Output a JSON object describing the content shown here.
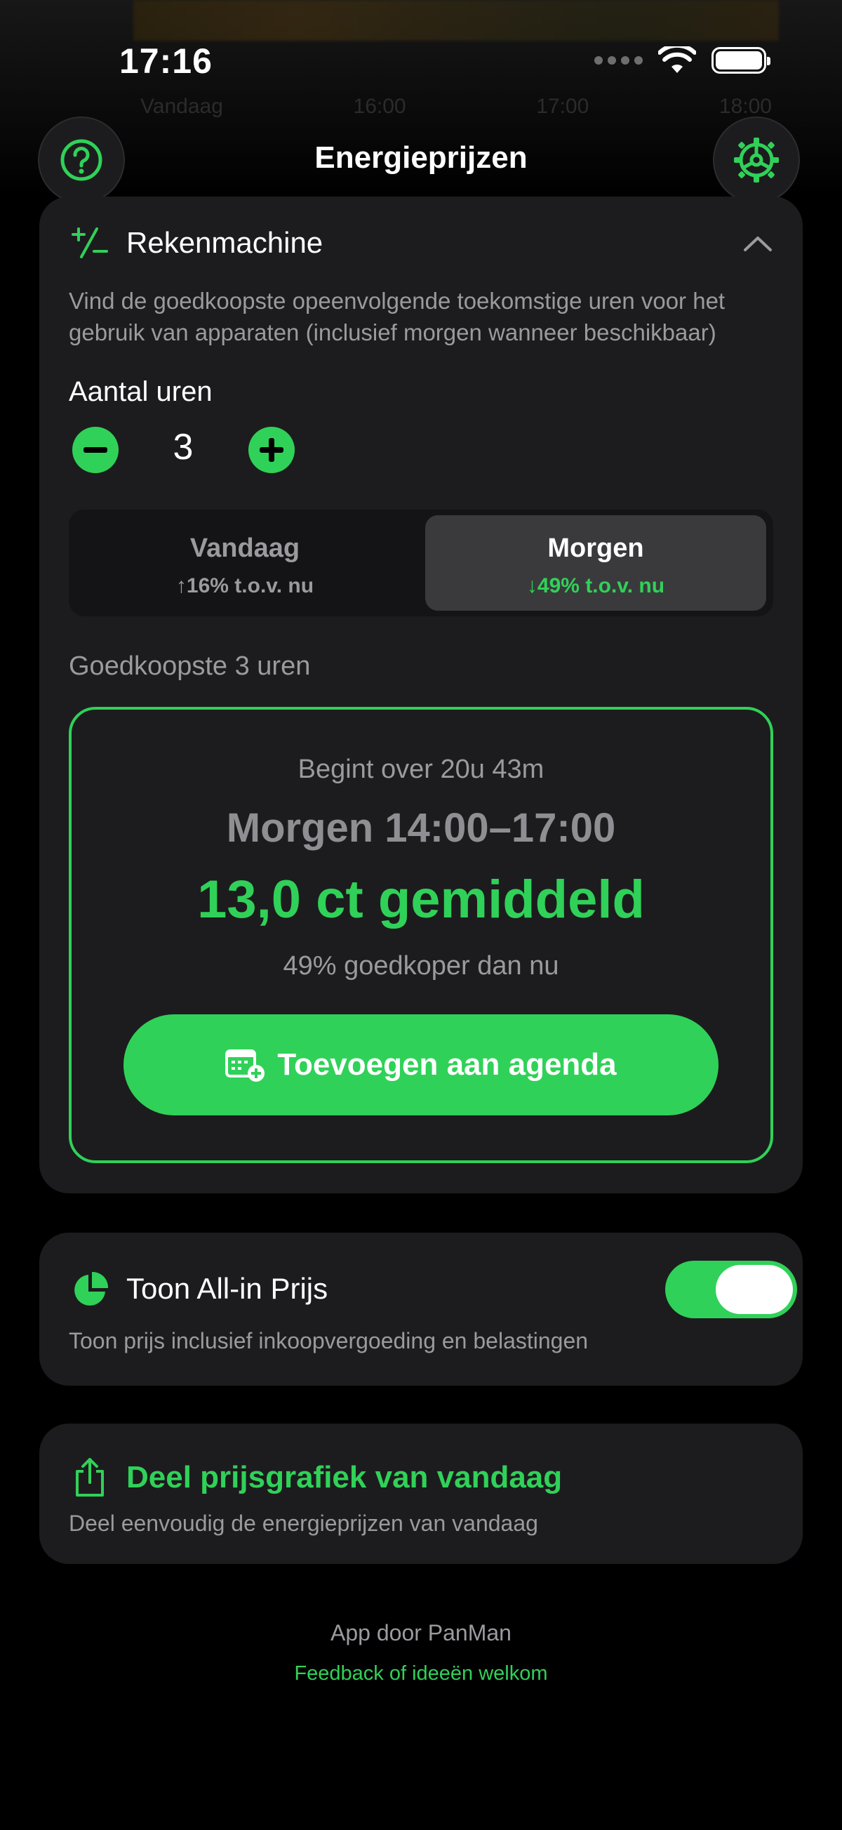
{
  "status_bar": {
    "time": "17:16"
  },
  "background": {
    "row": [
      "Vandaag",
      "16:00",
      "17:00",
      "18:00"
    ]
  },
  "header": {
    "title": "Energieprijzen",
    "help_icon": "question-circle-icon",
    "settings_icon": "gear-icon"
  },
  "calculator": {
    "title": "Rekenmachine",
    "description_line1": "Vind de goedkoopste opeenvolgende toekomstige uren voor het",
    "description_line2": "gebruik van apparaten (inclusief morgen wanneer beschikbaar)",
    "hours_label": "Aantal uren",
    "hours_value": "3",
    "segments": [
      {
        "label": "Vandaag",
        "sub": "↑16% t.o.v. nu",
        "active": false
      },
      {
        "label": "Morgen",
        "sub": "↓49% t.o.v. nu",
        "active": true
      }
    ],
    "cheapest_label": "Goedkoopste 3 uren",
    "result": {
      "starts_in": "Begint over 20u 43m",
      "window": "Morgen 14:00–17:00",
      "price": "13,0 ct gemiddeld",
      "saving": "49% goedkoper dan nu",
      "cta_label": "Toevoegen aan agenda"
    }
  },
  "all_in": {
    "title": "Toon All-in Prijs",
    "description": "Toon prijs inclusief inkoopvergoeding en belastingen",
    "enabled": true
  },
  "share": {
    "title": "Deel prijsgrafiek van vandaag",
    "description": "Deel eenvoudig de energieprijzen van vandaag"
  },
  "footer": {
    "credit": "App door PanMan",
    "feedback": "Feedback of ideeën welkom"
  },
  "colors": {
    "accent": "#30d158",
    "card": "#1c1c1e",
    "background": "#000000"
  }
}
